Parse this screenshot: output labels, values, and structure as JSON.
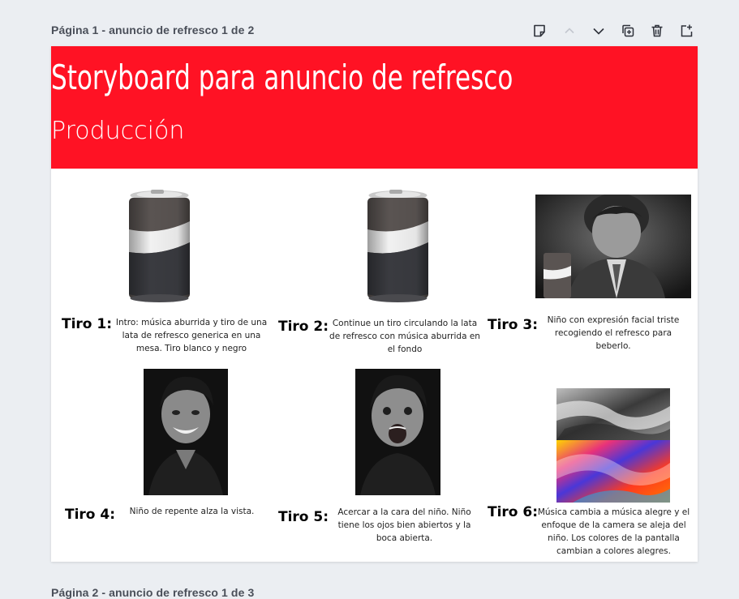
{
  "pages": {
    "current_label": "Página 1 - anuncio de refresco 1 de 2",
    "next_label": "Página 2 - anuncio de refresco 1 de 3"
  },
  "toolbar": {
    "icons": [
      "notes-icon",
      "chevron-up-icon",
      "chevron-down-icon",
      "duplicate-page-icon",
      "delete-icon",
      "add-page-icon"
    ]
  },
  "banner": {
    "title": "Storyboard para anuncio de refresco",
    "subtitle": "Producción",
    "color": "#ff1224"
  },
  "shots": [
    {
      "label": "Tiro 1:",
      "description": "Intro:  música aburrida  y tiro de una lata de refresco generica en una mesa. Tiro blanco y negro"
    },
    {
      "label": "Tiro 2:",
      "description": "Continue un tiro circulando la lata de refresco con música aburrida en el fondo"
    },
    {
      "label": "Tiro 3:",
      "description": "Niño con expresión facial triste recogiendo el refresco para beberlo."
    },
    {
      "label": "Tiro 4:",
      "description": "Niño de repente alza la vista."
    },
    {
      "label": "Tiro 5:",
      "description": "Acercar a la cara del niño. Niño tiene los ojos bien abiertos y la boca abierta."
    },
    {
      "label": "Tiro 6:",
      "description": "Música cambia a música alegre y el enfoque de la camera se aleja del niño. Los colores de la pantalla cambian a colores alegres."
    }
  ]
}
